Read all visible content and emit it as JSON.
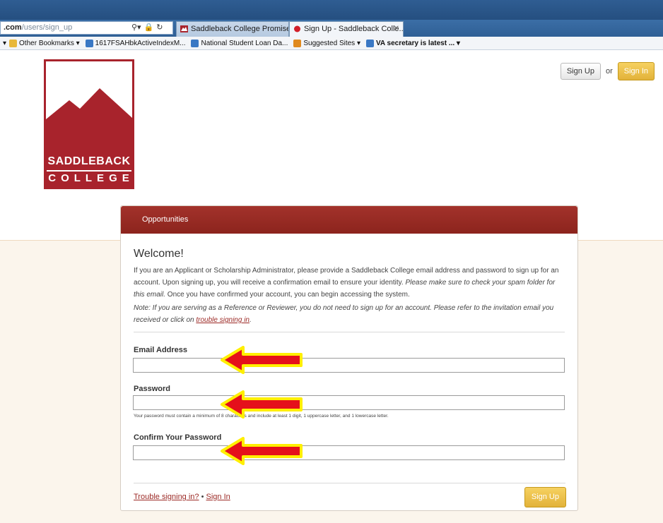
{
  "browser": {
    "address": {
      "prefix": ".com",
      "path": "/users/sign_up"
    },
    "tabs": [
      {
        "title": "Saddleback College Promise Pr..."
      },
      {
        "title": "Sign Up - Saddleback Colle...",
        "close": "✕"
      }
    ],
    "bookmarks": [
      {
        "label": "Other Bookmarks ▾"
      },
      {
        "label": "1617FSAHbkActiveIndexM..."
      },
      {
        "label": "National Student Loan Da..."
      },
      {
        "label": "Suggested Sites ▾"
      },
      {
        "label": "VA secretary is latest ... ▾"
      }
    ]
  },
  "logo": {
    "name": "SADDLEBACK",
    "college": "COLLEGE",
    "color": "#a8232c"
  },
  "header": {
    "signup_label": "Sign Up",
    "or_text": "or",
    "signin_label": "Sign In"
  },
  "card": {
    "tab_label": "Opportunities",
    "welcome": "Welcome!",
    "intro_plain": "If you are an Applicant or Scholarship Administrator, please provide a Saddleback College email address and password to sign up for an account. Upon signing up, you will receive a confirmation email to ensure your identity. ",
    "intro_italic": "Please make sure to check your spam folder for this email.",
    "intro_tail": " Once you have confirmed your account, you can begin accessing the system.",
    "note_text": "Note: If you are serving as a Reference or Reviewer, you do not need to sign up for an account. Please refer to the invitation email you received or click on ",
    "note_link": "trouble signing in",
    "note_end": "."
  },
  "form": {
    "email_label": "Email Address",
    "password_label": "Password",
    "password_help": "Your password must contain a minimum of 8 characters and include at least 1 digit, 1 uppercase letter, and 1 lowercase letter.",
    "confirm_label": "Confirm Your Password"
  },
  "footer": {
    "trouble_link": "Trouble signing in?",
    "separator": "•",
    "signin_link": "Sign In",
    "signup_button": "Sign Up"
  },
  "colors": {
    "accent": "#9c2a26",
    "button_gold": "#e2b23a",
    "arrow_red": "#e5101b",
    "arrow_outline": "#ffef00"
  }
}
